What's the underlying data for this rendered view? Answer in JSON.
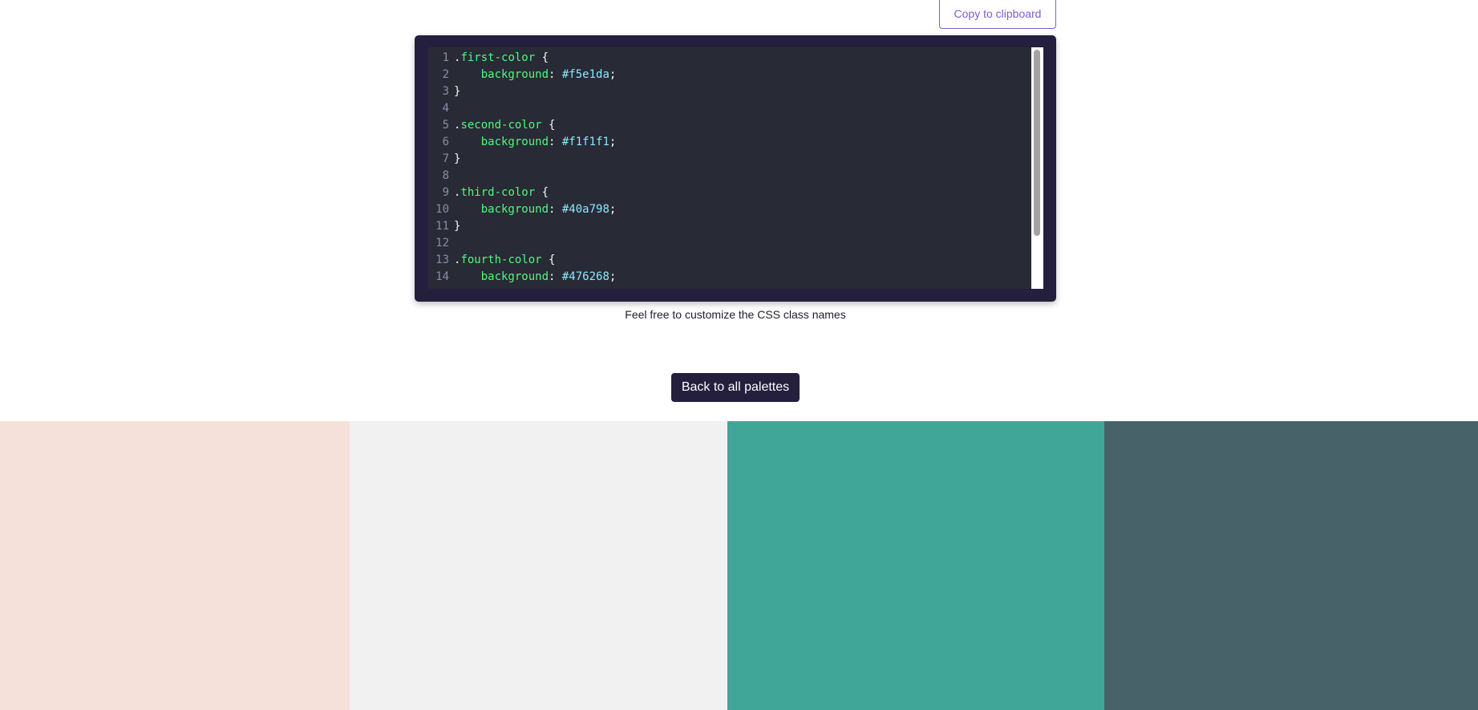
{
  "toolbar": {
    "copy_label": "Copy to clipboard"
  },
  "code": {
    "lines": [
      {
        "n": "1",
        "parts": [
          {
            "t": ".",
            "c": "tok-dot"
          },
          {
            "t": "first-color",
            "c": "tok-sel"
          },
          {
            "t": " {",
            "c": "tok-punc"
          }
        ]
      },
      {
        "n": "2",
        "parts": [
          {
            "t": "    ",
            "c": "tok-punc"
          },
          {
            "t": "background",
            "c": "tok-prop"
          },
          {
            "t": ": ",
            "c": "tok-punc"
          },
          {
            "t": "#f5e1da",
            "c": "tok-val"
          },
          {
            "t": ";",
            "c": "tok-punc"
          }
        ]
      },
      {
        "n": "3",
        "parts": [
          {
            "t": "}",
            "c": "tok-punc"
          }
        ]
      },
      {
        "n": "4",
        "parts": []
      },
      {
        "n": "5",
        "parts": [
          {
            "t": ".",
            "c": "tok-dot"
          },
          {
            "t": "second-color",
            "c": "tok-sel"
          },
          {
            "t": " {",
            "c": "tok-punc"
          }
        ]
      },
      {
        "n": "6",
        "parts": [
          {
            "t": "    ",
            "c": "tok-punc"
          },
          {
            "t": "background",
            "c": "tok-prop"
          },
          {
            "t": ": ",
            "c": "tok-punc"
          },
          {
            "t": "#f1f1f1",
            "c": "tok-val"
          },
          {
            "t": ";",
            "c": "tok-punc"
          }
        ]
      },
      {
        "n": "7",
        "parts": [
          {
            "t": "}",
            "c": "tok-punc"
          }
        ]
      },
      {
        "n": "8",
        "parts": []
      },
      {
        "n": "9",
        "parts": [
          {
            "t": ".",
            "c": "tok-dot"
          },
          {
            "t": "third-color",
            "c": "tok-sel"
          },
          {
            "t": " {",
            "c": "tok-punc"
          }
        ]
      },
      {
        "n": "10",
        "parts": [
          {
            "t": "    ",
            "c": "tok-punc"
          },
          {
            "t": "background",
            "c": "tok-prop"
          },
          {
            "t": ": ",
            "c": "tok-punc"
          },
          {
            "t": "#40a798",
            "c": "tok-val"
          },
          {
            "t": ";",
            "c": "tok-punc"
          }
        ]
      },
      {
        "n": "11",
        "parts": [
          {
            "t": "}",
            "c": "tok-punc"
          }
        ]
      },
      {
        "n": "12",
        "parts": []
      },
      {
        "n": "13",
        "parts": [
          {
            "t": ".",
            "c": "tok-dot"
          },
          {
            "t": "fourth-color",
            "c": "tok-sel"
          },
          {
            "t": " {",
            "c": "tok-punc"
          }
        ]
      },
      {
        "n": "14",
        "parts": [
          {
            "t": "    ",
            "c": "tok-punc"
          },
          {
            "t": "background",
            "c": "tok-prop"
          },
          {
            "t": ": ",
            "c": "tok-punc"
          },
          {
            "t": "#476268",
            "c": "tok-val"
          },
          {
            "t": ";",
            "c": "tok-punc"
          }
        ]
      }
    ]
  },
  "hint": "Feel free to customize the CSS class names",
  "back_label": "Back to all palettes",
  "palette": {
    "swatches": [
      {
        "name": "first-color",
        "color": "#f5e1da",
        "share": 0.2363
      },
      {
        "name": "second-color",
        "color": "#f1f1f1",
        "share": 0.2555
      },
      {
        "name": "third-color",
        "color": "#40a798",
        "share": 0.2555
      },
      {
        "name": "fourth-color",
        "color": "#476268",
        "share": 0.2527
      }
    ]
  },
  "colors": {
    "accent": "#7c5cd6",
    "frame": "#231f3d",
    "editor_bg": "#282a36"
  }
}
